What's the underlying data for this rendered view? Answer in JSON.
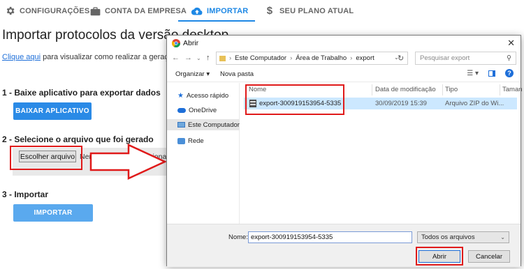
{
  "nav": {
    "items": [
      {
        "label": "CONFIGURAÇÕES",
        "icon": "gear-icon"
      },
      {
        "label": "CONTA DA EMPRESA",
        "icon": "briefcase-icon"
      },
      {
        "label": "IMPORTAR",
        "icon": "cloud-upload-icon",
        "active": true
      },
      {
        "label": "SEU PLANO ATUAL",
        "icon": "dollar-icon"
      }
    ],
    "accent": "#1e88e5"
  },
  "page": {
    "title": "Importar protocolos da versão desktop",
    "help_link": "Clique aqui",
    "help_text": " para visualizar como realizar a geração do",
    "step1": "1 - Baixe aplicativo para exportar dados",
    "download_button": "BAIXAR APLICATIVO",
    "step2": "2 - Selecione o arquivo que foi gerado",
    "choose_file_button": "Escolher arquivo",
    "no_file_text": "Nenhum arquivo selecionado",
    "step3": "3 - Importar",
    "import_button": "IMPORTAR"
  },
  "dialog": {
    "title": "Abrir",
    "breadcrumb": [
      "Este Computador",
      "Área de Trabalho",
      "export"
    ],
    "search_placeholder": "Pesquisar export",
    "organize_label": "Organizar",
    "new_folder_label": "Nova pasta",
    "nav_items": [
      {
        "label": "Acesso rápido",
        "icon": "star-icon"
      },
      {
        "label": "OneDrive",
        "icon": "cloud-icon"
      },
      {
        "label": "Este Computador",
        "icon": "computer-icon",
        "selected": true
      },
      {
        "label": "Rede",
        "icon": "network-icon"
      }
    ],
    "columns": [
      "Nome",
      "Data de modificação",
      "Tipo",
      "Taman"
    ],
    "files": [
      {
        "name": "export-300919153954-5335",
        "modified": "30/09/2019 15:39",
        "type": "Arquivo ZIP do Wi..."
      }
    ],
    "filename_label": "Nome:",
    "filename_value": "export-300919153954-5335",
    "filetype_value": "Todos os arquivos",
    "open_button": "Abrir",
    "cancel_button": "Cancelar"
  },
  "highlight_color": "#e01a1a"
}
